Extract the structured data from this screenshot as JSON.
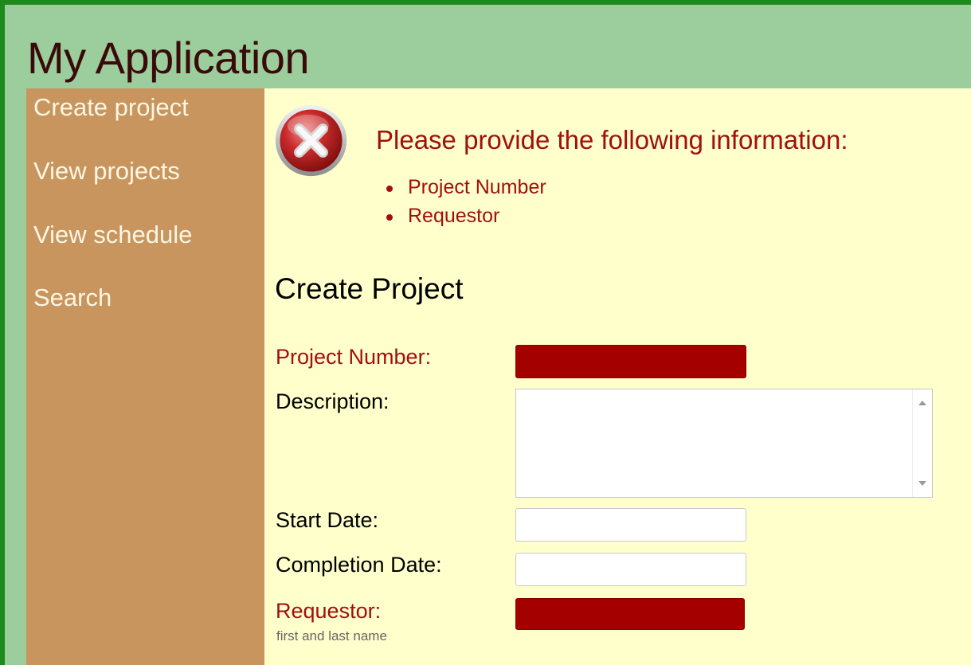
{
  "app": {
    "title": "My Application"
  },
  "sidebar": {
    "items": [
      {
        "label": "Create project"
      },
      {
        "label": "View projects"
      },
      {
        "label": "View schedule"
      },
      {
        "label": "Search"
      }
    ]
  },
  "validation": {
    "icon": "error-x-icon",
    "heading": "Please provide the following information:",
    "errors": [
      "Project Number",
      "Requestor"
    ],
    "color": "#a10f0f"
  },
  "form": {
    "title": "Create Project",
    "fields": {
      "project_number": {
        "label": "Project Number:",
        "value": ""
      },
      "description": {
        "label": "Description:",
        "value": ""
      },
      "start_date": {
        "label": "Start Date:",
        "value": ""
      },
      "completion_date": {
        "label": "Completion Date:",
        "value": ""
      },
      "requestor": {
        "label": "Requestor:",
        "hint": "first and last name",
        "value": ""
      }
    }
  },
  "colors": {
    "frame_border": "#1e8a1e",
    "header_bg": "#9ccd9c",
    "sidebar_bg": "#c9955f",
    "content_bg": "#ffffcc",
    "invalid_field": "#a50000"
  }
}
